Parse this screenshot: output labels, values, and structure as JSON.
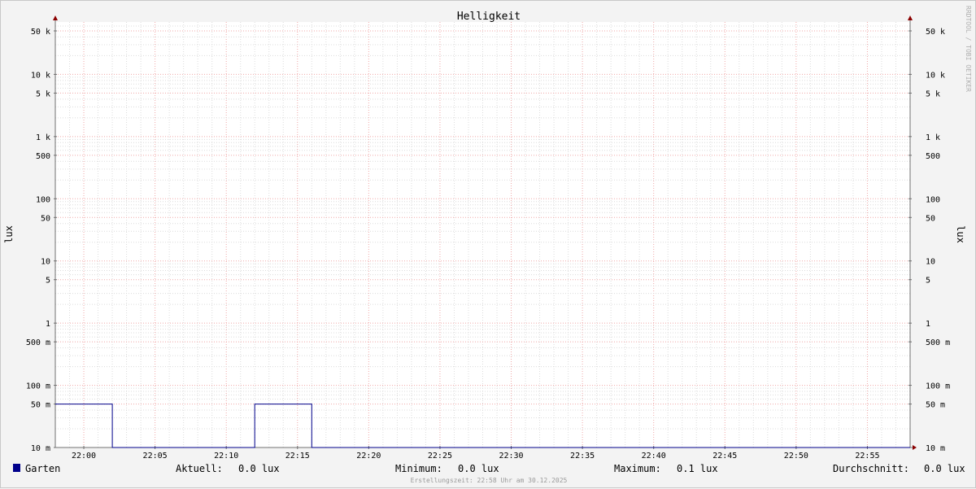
{
  "chart_data": {
    "type": "line",
    "title": "Helligkeit",
    "ylabel": "lux",
    "y_scale": "log",
    "ylim": [
      0.01,
      80000
    ],
    "x_range": [
      "21:58",
      "22:58"
    ],
    "x_ticks": [
      "22:00",
      "22:05",
      "22:10",
      "22:15",
      "22:20",
      "22:25",
      "22:30",
      "22:35",
      "22:40",
      "22:45",
      "22:50",
      "22:55"
    ],
    "y_ticks": [
      {
        "value": 50000,
        "label": "50 k"
      },
      {
        "value": 10000,
        "label": "10 k"
      },
      {
        "value": 5000,
        "label": "5 k"
      },
      {
        "value": 1000,
        "label": "1 k"
      },
      {
        "value": 500,
        "label": "500"
      },
      {
        "value": 100,
        "label": "100"
      },
      {
        "value": 50,
        "label": "50"
      },
      {
        "value": 10,
        "label": "10"
      },
      {
        "value": 5,
        "label": "5"
      },
      {
        "value": 1,
        "label": "1"
      },
      {
        "value": 0.5,
        "label": "500 m"
      },
      {
        "value": 0.1,
        "label": "100 m"
      },
      {
        "value": 0.05,
        "label": "50 m"
      },
      {
        "value": 0.01,
        "label": "10 m"
      }
    ],
    "series": [
      {
        "name": "Garten",
        "color": "#00008b",
        "step": true,
        "x": [
          "21:58",
          "22:02",
          "22:02",
          "22:12",
          "22:12",
          "22:16",
          "22:16",
          "22:58"
        ],
        "values": [
          0.05,
          0.05,
          0.01,
          0.01,
          0.05,
          0.05,
          0.01,
          0.01
        ]
      }
    ],
    "grid": true
  },
  "legend": {
    "series_name": "Garten",
    "swatch_color": "#00008b",
    "current_label": "Aktuell:",
    "current_value": "0.0 lux",
    "min_label": "Minimum:",
    "min_value": "0.0 lux",
    "max_label": "Maximum:",
    "max_value": "0.1 lux",
    "avg_label": "Durchschnitt:",
    "avg_value": "0.0 lux"
  },
  "footer": "Erstellungszeit: 22:58 Uhr am 30.12.2025",
  "watermark": "RRDTOOL / TOBI OETIKER"
}
